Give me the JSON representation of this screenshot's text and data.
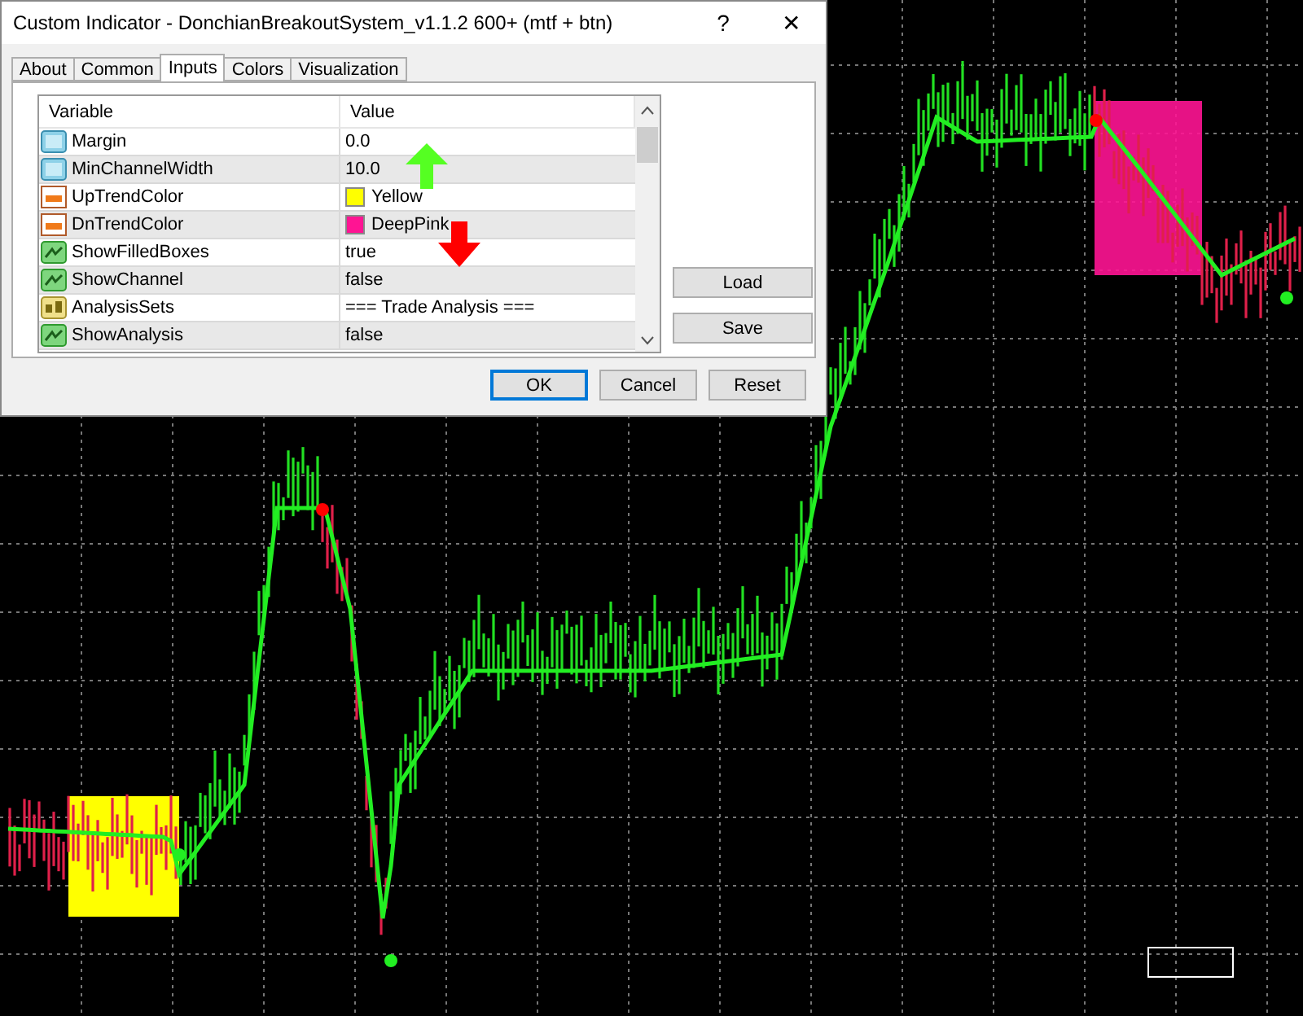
{
  "window": {
    "title": "Custom Indicator - DonchianBreakoutSystem_v1.1.2 600+ (mtf + btn)",
    "help": "?",
    "close": "✕"
  },
  "tabs": [
    {
      "label": "About",
      "selected": false
    },
    {
      "label": "Common",
      "selected": false
    },
    {
      "label": "Inputs",
      "selected": true
    },
    {
      "label": "Colors",
      "selected": false
    },
    {
      "label": "Visualization",
      "selected": false
    }
  ],
  "table": {
    "columns": [
      "Variable",
      "Value"
    ],
    "rows": [
      {
        "kind": "double",
        "variable": "Margin",
        "value": "0.0"
      },
      {
        "kind": "double",
        "variable": "MinChannelWidth",
        "value": "10.0"
      },
      {
        "kind": "color",
        "variable": "UpTrendColor",
        "value": "Yellow",
        "color": "#ffff00"
      },
      {
        "kind": "color",
        "variable": "DnTrendColor",
        "value": "DeepPink",
        "color": "#ff1493"
      },
      {
        "kind": "bool",
        "variable": "ShowFilledBoxes",
        "value": "true"
      },
      {
        "kind": "bool",
        "variable": "ShowChannel",
        "value": "false"
      },
      {
        "kind": "string",
        "variable": "AnalysisSets",
        "value": "=== Trade Analysis ==="
      },
      {
        "kind": "bool",
        "variable": "ShowAnalysis",
        "value": "false"
      }
    ]
  },
  "side_buttons": [
    "Load",
    "Save"
  ],
  "buttons": [
    {
      "label": "OK",
      "default": true
    },
    {
      "label": "Cancel",
      "default": false
    },
    {
      "label": "Reset",
      "default": false
    }
  ]
}
